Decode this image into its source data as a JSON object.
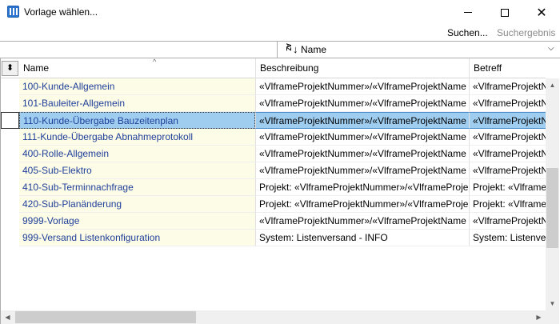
{
  "window": {
    "title": "Vorlage wählen...",
    "close_glyph": "✕"
  },
  "toolbar": {
    "search_label": "Suchen...",
    "results_label": "Suchergebnis"
  },
  "search": {
    "value": "",
    "placeholder": ""
  },
  "sort": {
    "az_glyph": "AZ",
    "arrow_glyph": "↓",
    "label": "Name",
    "caret": "⌵"
  },
  "grid": {
    "columns": [
      {
        "label": "Name"
      },
      {
        "label": "Beschreibung"
      },
      {
        "label": "Betreff"
      }
    ],
    "corner_glyph": "⬍",
    "sort_indicator": "^",
    "rows": [
      {
        "name": "100-Kunde-Allgemein",
        "beschreibung": "«VlframeProjektNummer»/«VlframeProjektName",
        "betreff": "«VlframeProjektN"
      },
      {
        "name": "101-Bauleiter-Allgemein",
        "beschreibung": "«VlframeProjektNummer»/«VlframeProjektName",
        "betreff": "«VlframeProjektN"
      },
      {
        "name": "110-Kunde-Übergabe Bauzeitenplan",
        "beschreibung": "«VlframeProjektNummer»/«VlframeProjektName",
        "betreff": "«VlframeProjektN",
        "selected": true
      },
      {
        "name": "111-Kunde-Übergabe Abnahmeprotokoll",
        "beschreibung": "«VlframeProjektNummer»/«VlframeProjektName",
        "betreff": "«VlframeProjektN"
      },
      {
        "name": "400-Rolle-Allgemein",
        "beschreibung": "«VlframeProjektNummer»/«VlframeProjektName",
        "betreff": "«VlframeProjektN"
      },
      {
        "name": "405-Sub-Elektro",
        "beschreibung": "«VlframeProjektNummer»/«VlframeProjektName",
        "betreff": "«VlframeProjektN"
      },
      {
        "name": "410-Sub-Terminnachfrage",
        "beschreibung": "Projekt: «VlframeProjektNummer»/«VlframeProje",
        "betreff": "Projekt: «Vlframel"
      },
      {
        "name": "420-Sub-Planänderung",
        "beschreibung": "Projekt: «VlframeProjektNummer»/«VlframeProje",
        "betreff": "Projekt: «Vlframel"
      },
      {
        "name": "9999-Vorlage",
        "beschreibung": "«VlframeProjektNummer»/«VlframeProjektName",
        "betreff": "«VlframeProjektN"
      },
      {
        "name": "999-Versand Listenkonfiguration",
        "beschreibung": "System: Listenversand - INFO",
        "betreff": "System: Listenver"
      }
    ]
  },
  "scrollbars": {
    "up_glyph": "▲",
    "down_glyph": "▼",
    "left_glyph": "◀",
    "right_glyph": "▶"
  },
  "colors": {
    "name_column_bg": "#fdfce6",
    "name_text": "#1f3f9a",
    "selection": "#9fcdf0"
  }
}
